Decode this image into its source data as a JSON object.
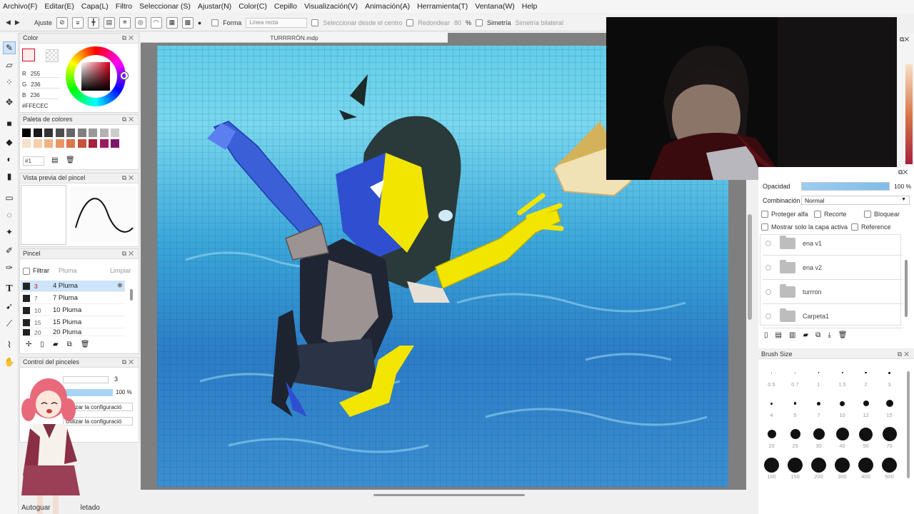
{
  "menu": [
    "Archivo(F)",
    "Editar(E)",
    "Capa(L)",
    "Filtro",
    "Seleccionar (S)",
    "Ajustar(N)",
    "Color(C)",
    "Cepillo",
    "Visualización(V)",
    "Animación(A)",
    "Herramienta(T)",
    "Ventana(W)",
    "Help"
  ],
  "toolbar": {
    "ajuste": "Ajuste",
    "forma": "Forma",
    "forma_value": "Línea recta",
    "seleccionar_centro": "Seleccionar desde el centro",
    "redondear": "Redondear",
    "redondear_value": "80",
    "percent": "%",
    "simetria": "Simetría",
    "simetria_value": "Simetría bilateral"
  },
  "color_panel": {
    "title": "Color",
    "r_label": "R",
    "r": "255",
    "g_label": "G",
    "g": "236",
    "b_label": "B",
    "b": "236",
    "hex": "#FFECEC",
    "accent": "#ffecec"
  },
  "palette_panel": {
    "title": "Paleta de colores",
    "row1": [
      "#000000",
      "#1a1a1a",
      "#333333",
      "#4d4d4d",
      "#666666",
      "#808080",
      "#999999",
      "#b3b3b3",
      "#cccccc"
    ],
    "row2": [
      "#f9e0c8",
      "#f7cfa8",
      "#f2b384",
      "#e99565",
      "#d9784a",
      "#c7523a",
      "#a8203a",
      "#9b1c5e",
      "#7a1a6b"
    ],
    "selector": "#1"
  },
  "brush_preview": {
    "title": "Vista previa del pincel"
  },
  "pincel_panel": {
    "title": "Pincel",
    "filter_label": "Filtrar",
    "filter_value": "Pluma",
    "clear_label": "Limpiar",
    "items": [
      {
        "num": "3",
        "name": "4 Pluma"
      },
      {
        "num": "7",
        "name": "7 Pluma"
      },
      {
        "num": "10",
        "name": "10 Pluma"
      },
      {
        "num": "15",
        "name": "15 Pluma"
      },
      {
        "num": "20",
        "name": "20 Pluma"
      }
    ]
  },
  "control_panel": {
    "title": "Control del pinceles",
    "size_value": "3",
    "opacity_value": "100 %",
    "opt1": "Utilizar la configuració",
    "opt2": "Utilizar la configuració"
  },
  "document": {
    "tab_title": "TURRRRÓN.mdp"
  },
  "layer_panel": {
    "opacity_label": "Opacidad",
    "opacity_value": "100 %",
    "opacity_level": 1.0,
    "blend_label": "Combinación",
    "blend_value": "Normal",
    "proteger_alfa": "Proteger alfa",
    "recorte": "Recorte",
    "bloquear": "Bloquear",
    "mostrar_solo": "Mostrar solo la capa activa",
    "reference": "Reference",
    "layers": [
      "ena v1",
      "ena v2",
      "turrron",
      "Carpeta1"
    ]
  },
  "brush_size_panel": {
    "title": "Brush Size",
    "sizes": [
      "0.5",
      "0.7",
      "1",
      "1.5",
      "2",
      "3",
      "4",
      "5",
      "7",
      "10",
      "12",
      "15",
      "20",
      "25",
      "30",
      "40",
      "50",
      "70",
      "100",
      "150",
      "200",
      "300",
      "400",
      "500"
    ]
  },
  "status_bar": {
    "text_left": "Autoguar",
    "text_right": "letado"
  }
}
